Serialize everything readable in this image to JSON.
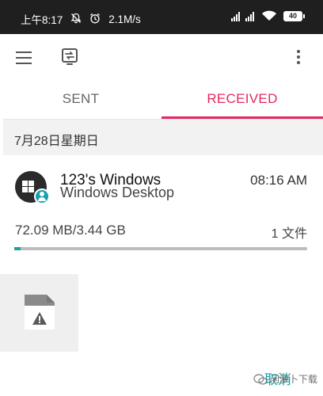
{
  "status_bar": {
    "time": "上午8:17",
    "speed": "2.1M/s",
    "battery": "40",
    "icons": [
      "mute-icon",
      "alarm-icon",
      "signal-icon",
      "wifi-icon",
      "battery-icon"
    ]
  },
  "app_bar": {
    "icons": [
      "menu-icon",
      "device-icon",
      "more-vert-icon"
    ]
  },
  "tabs": [
    {
      "label": "SENT",
      "active": false
    },
    {
      "label": "RECEIVED",
      "active": true
    }
  ],
  "date_header": "7月28日星期日",
  "transfer": {
    "device_name": "123's Windows",
    "device_type": "Windows Desktop",
    "time": "08:16 AM",
    "size": "72.09 MB/3.44 GB",
    "file_count": "1 文件",
    "progress": 0.021
  },
  "file_tile": {
    "icon": "file-warning-icon"
  },
  "cancel_label": "取消",
  "watermark": "闲萝卜下载",
  "colors": {
    "accent_pink": "#e5285f",
    "accent_teal": "#1aa0a8",
    "status_bar": "#1f1f1f"
  }
}
